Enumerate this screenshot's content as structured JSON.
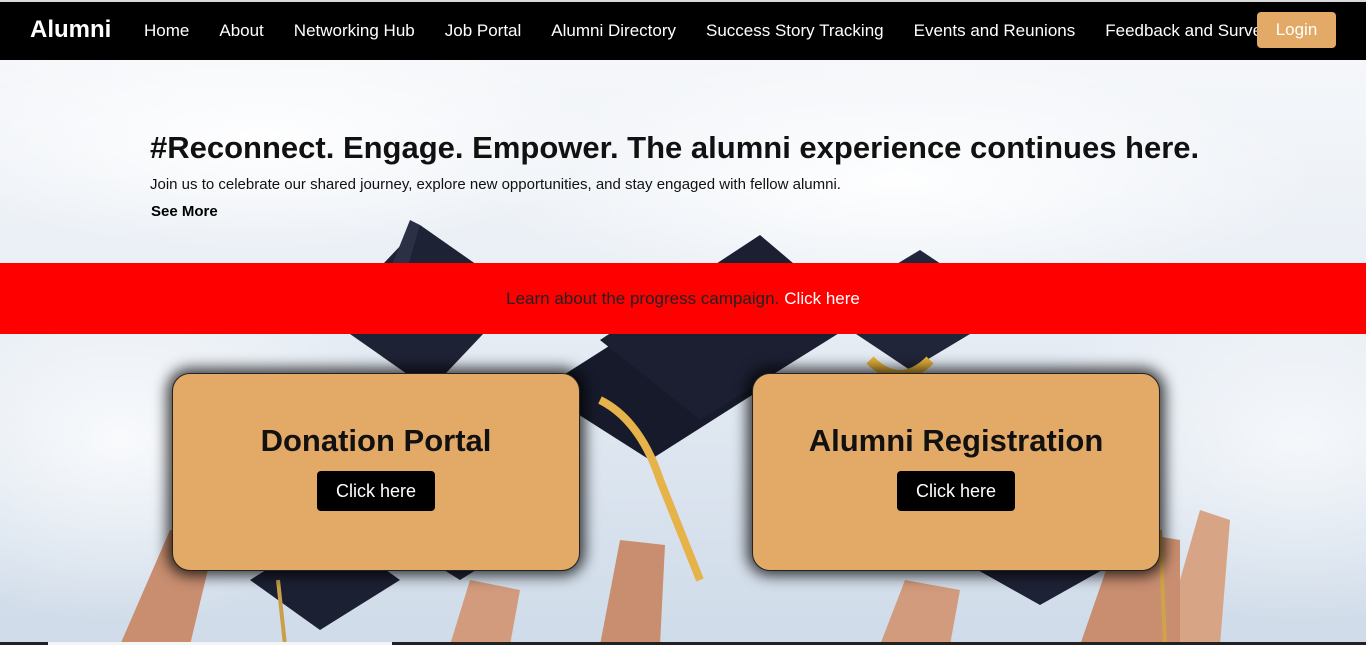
{
  "nav": {
    "brand": "Alumni",
    "links": [
      "Home",
      "About",
      "Networking Hub",
      "Job Portal",
      "Alumni Directory",
      "Success Story Tracking",
      "Events and Reunions",
      "Feedback and Surveys"
    ],
    "login_label": "Login"
  },
  "hero": {
    "headline": "#Reconnect. Engage. Empower. The alumni experience continues here.",
    "subtext": "Join us to celebrate our shared journey, explore new opportunities, and stay engaged with fellow alumni.",
    "see_more": "See More"
  },
  "banner": {
    "text": "Learn about the progress campaign.",
    "link": "Click here"
  },
  "cards": [
    {
      "title": "Donation Portal",
      "button": "Click here"
    },
    {
      "title": "Alumni Registration",
      "button": "Click here"
    }
  ],
  "colors": {
    "accent": "#e3a966",
    "banner": "#ff0000",
    "nav_bg": "#000000"
  }
}
